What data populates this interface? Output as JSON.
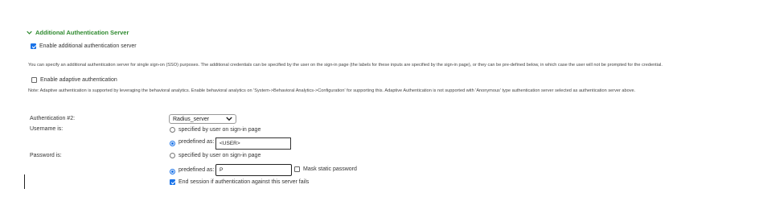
{
  "section": {
    "title": "Additional Authentication Server"
  },
  "enable_additional": {
    "label": "Enable additional authentication server",
    "checked": true
  },
  "description": "You can specify an additional authentication server for single sign-on (SSO) purposes. The additional credentials can be specified by the user on the sign-in page (the labels for these inputs are specified by the sign-in page), or they can be pre-defined below, in which case the user will not be prompted for the credential.",
  "adaptive": {
    "label": "Enable adaptive authentication",
    "checked": false
  },
  "adaptive_note": "Note: Adaptive authentication is supported by leveraging the behavioral analytics. Enable behavioral analytics on 'System->Behavioral Analytics->Configuration' for supporting this. Adaptive Authentication is not supported with 'Anonymous' type authentication server selected as authentication server above.",
  "auth2": {
    "label": "Authentication #2:",
    "selected": "Radius_server"
  },
  "username": {
    "label": "Username is:",
    "opt_user": "specified by user on sign-in page",
    "opt_predefined": "predefined as:",
    "value": "<USER>",
    "selected": "predefined"
  },
  "password": {
    "label": "Password is:",
    "opt_user": "specified by user on sign-in page",
    "opt_predefined": "predefined as:",
    "value": "P",
    "selected": "predefined",
    "mask_label": "Mask static password",
    "mask_checked": false
  },
  "end_session": {
    "label": "End session if authentication against this server fails",
    "checked": true
  }
}
